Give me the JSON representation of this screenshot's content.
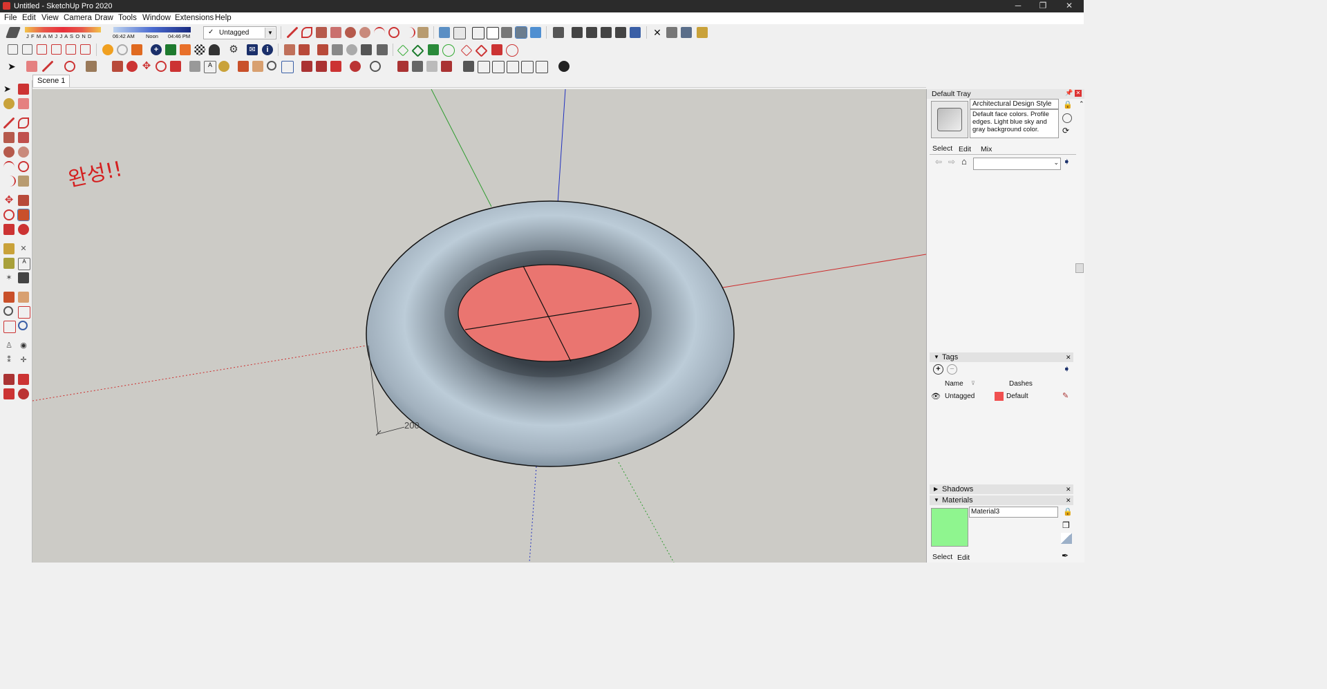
{
  "window": {
    "title": "Untitled - SketchUp Pro 2020",
    "minimize": "─",
    "restore": "❐",
    "close": "✕"
  },
  "menu": [
    "File",
    "Edit",
    "View",
    "Camera",
    "Draw",
    "Tools",
    "Window",
    "Extensions",
    "Help"
  ],
  "shadow_toolbar": {
    "months": "J F M A M J J A S O N D",
    "time_start": "06:42 AM",
    "time_mid": "Noon",
    "time_end": "04:46 PM"
  },
  "tag_dropdown": {
    "check": "✓",
    "value": "Untagged"
  },
  "scene_tab": "Scene 1",
  "viewport": {
    "annotation": "완성!!",
    "dimension_label": "200"
  },
  "tray": {
    "title": "Default Tray",
    "styles": {
      "style_name": "Architectural Design Style",
      "description": "Default face colors. Profile edges. Light blue sky and gray background color.",
      "tabs": [
        "Select",
        "Edit",
        "Mix"
      ]
    },
    "tags_panel": {
      "title": "Tags",
      "col_name": "Name",
      "col_dashes": "Dashes",
      "row": {
        "name": "Untagged",
        "dashes": "Default",
        "color": "#f05050"
      }
    },
    "shadows_panel": {
      "title": "Shadows"
    },
    "materials_panel": {
      "title": "Materials",
      "material_name": "Material3",
      "swatch_color": "#8ff58f",
      "tabs": [
        "Select",
        "Edit"
      ]
    }
  },
  "colors": {
    "face": "#ea7570",
    "axis_red": "#cc2a2a",
    "axis_green": "#2e9c2e",
    "axis_blue": "#2030c0",
    "background": "#cccbc6"
  }
}
